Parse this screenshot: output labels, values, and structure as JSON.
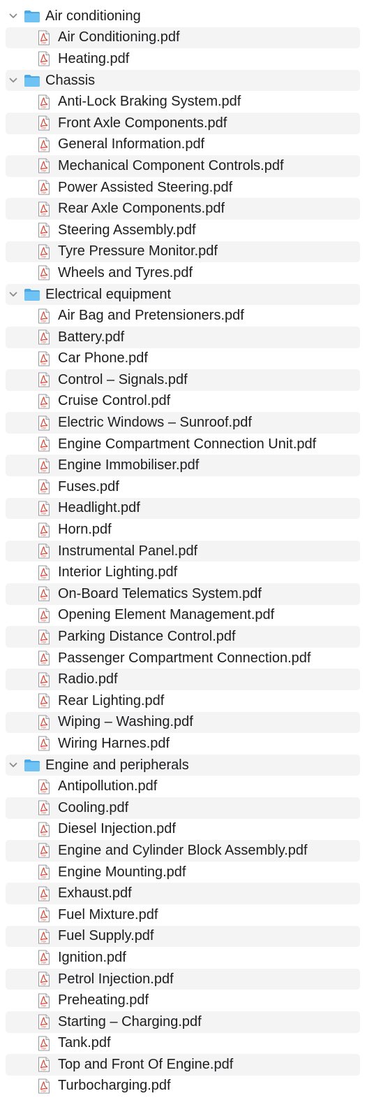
{
  "groups": [
    {
      "label": "Air conditioning",
      "files": [
        "Air Conditioning.pdf",
        "Heating.pdf"
      ]
    },
    {
      "label": "Chassis",
      "files": [
        "Anti-Lock Braking System.pdf",
        "Front Axle Components.pdf",
        "General Information.pdf",
        "Mechanical Component Controls.pdf",
        "Power Assisted Steering.pdf",
        "Rear Axle Components.pdf",
        "Steering Assembly.pdf",
        "Tyre Pressure Monitor.pdf",
        "Wheels and Tyres.pdf"
      ]
    },
    {
      "label": "Electrical equipment",
      "files": [
        "Air Bag and Pretensioners.pdf",
        "Battery.pdf",
        "Car Phone.pdf",
        "Control – Signals.pdf",
        "Cruise Control.pdf",
        "Electric Windows – Sunroof.pdf",
        "Engine Compartment Connection Unit.pdf",
        "Engine Immobiliser.pdf",
        "Fuses.pdf",
        "Headlight.pdf",
        "Horn.pdf",
        "Instrumental Panel.pdf",
        "Interior Lighting.pdf",
        "On-Board Telematics System.pdf",
        "Opening Element Management.pdf",
        "Parking Distance Control.pdf",
        "Passenger Compartment Connection.pdf",
        "Radio.pdf",
        "Rear Lighting.pdf",
        "Wiping – Washing.pdf",
        "Wiring Harnes.pdf"
      ]
    },
    {
      "label": "Engine and peripherals",
      "files": [
        "Antipollution.pdf",
        "Cooling.pdf",
        "Diesel Injection.pdf",
        "Engine and Cylinder Block Assembly.pdf",
        "Engine Mounting.pdf",
        "Exhaust.pdf",
        "Fuel Mixture.pdf",
        "Fuel Supply.pdf",
        "Ignition.pdf",
        "Petrol Injection.pdf",
        "Preheating.pdf",
        "Starting – Charging.pdf",
        "Tank.pdf",
        "Top and Front Of Engine.pdf",
        "Turbocharging.pdf"
      ]
    }
  ],
  "icons": {
    "folder": "folder-icon",
    "file": "pdf-file-icon",
    "disclosure": "chevron-down-icon"
  },
  "colors": {
    "folder": "#5ab6f0",
    "pdf_accent": "#d64535",
    "stripe": "#f4f4f5"
  }
}
